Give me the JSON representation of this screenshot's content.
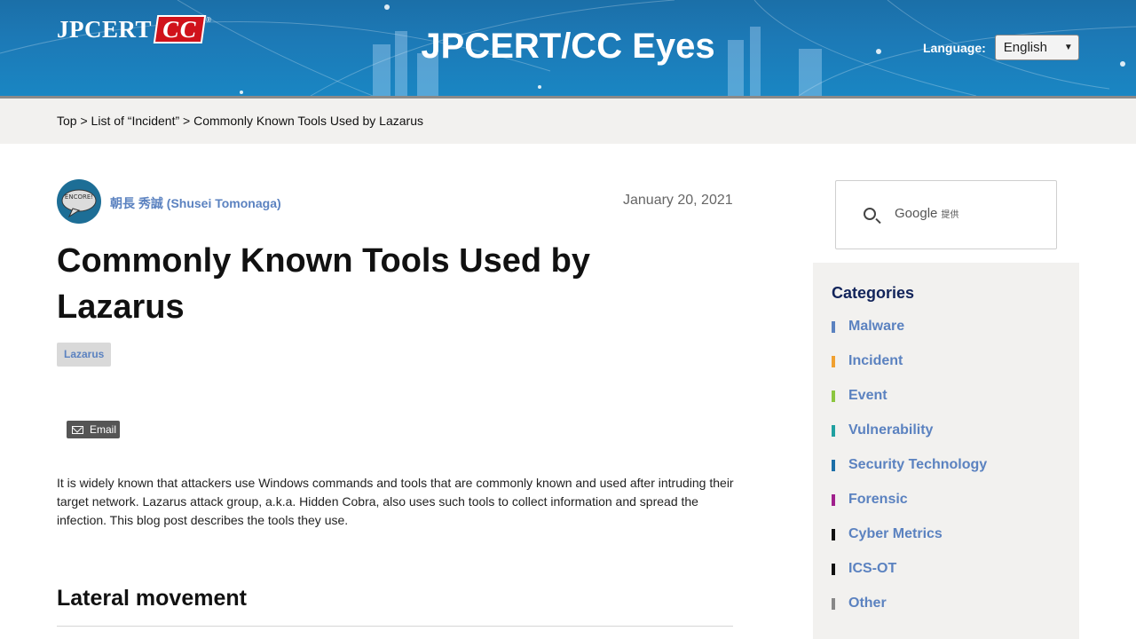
{
  "header": {
    "logo_text": "JPCERT",
    "logo_cc": "CC",
    "logo_reg": "®",
    "site_title": "JPCERT/CC Eyes",
    "language_label": "Language:",
    "language_value": "English"
  },
  "breadcrumb": {
    "top": "Top",
    "sep1": " > ",
    "list": "List of “Incident”",
    "sep2": " > ",
    "current": "Commonly Known Tools Used by Lazarus"
  },
  "post": {
    "avatar_text": "ENCORE!",
    "author": "朝長 秀誠 (Shusei Tomonaga)",
    "date": "January 20, 2021",
    "title": "Commonly Known Tools Used by Lazarus",
    "tag": "Lazarus",
    "email_label": "Email",
    "intro": "It is widely known that attackers use Windows commands and tools that are commonly known and used after intruding their target network. Lazarus attack group, a.k.a. Hidden Cobra, also uses such tools to collect information and spread the infection. This blog post describes the tools they use.",
    "section_heading": "Lateral movement"
  },
  "sidebar": {
    "search_provider": "Google",
    "search_provider_suffix": "提供",
    "categories_title": "Categories",
    "categories": [
      {
        "label": "Malware",
        "color": "#5b82c0"
      },
      {
        "label": "Incident",
        "color": "#f0a030"
      },
      {
        "label": "Event",
        "color": "#8cc63f"
      },
      {
        "label": "Vulnerability",
        "color": "#20a0a0"
      },
      {
        "label": "Security Technology",
        "color": "#1d6fa8"
      },
      {
        "label": "Forensic",
        "color": "#a0208c"
      },
      {
        "label": "Cyber Metrics",
        "color": "#111111"
      },
      {
        "label": "ICS-OT",
        "color": "#111111"
      },
      {
        "label": "Other",
        "color": "#888888"
      }
    ]
  }
}
